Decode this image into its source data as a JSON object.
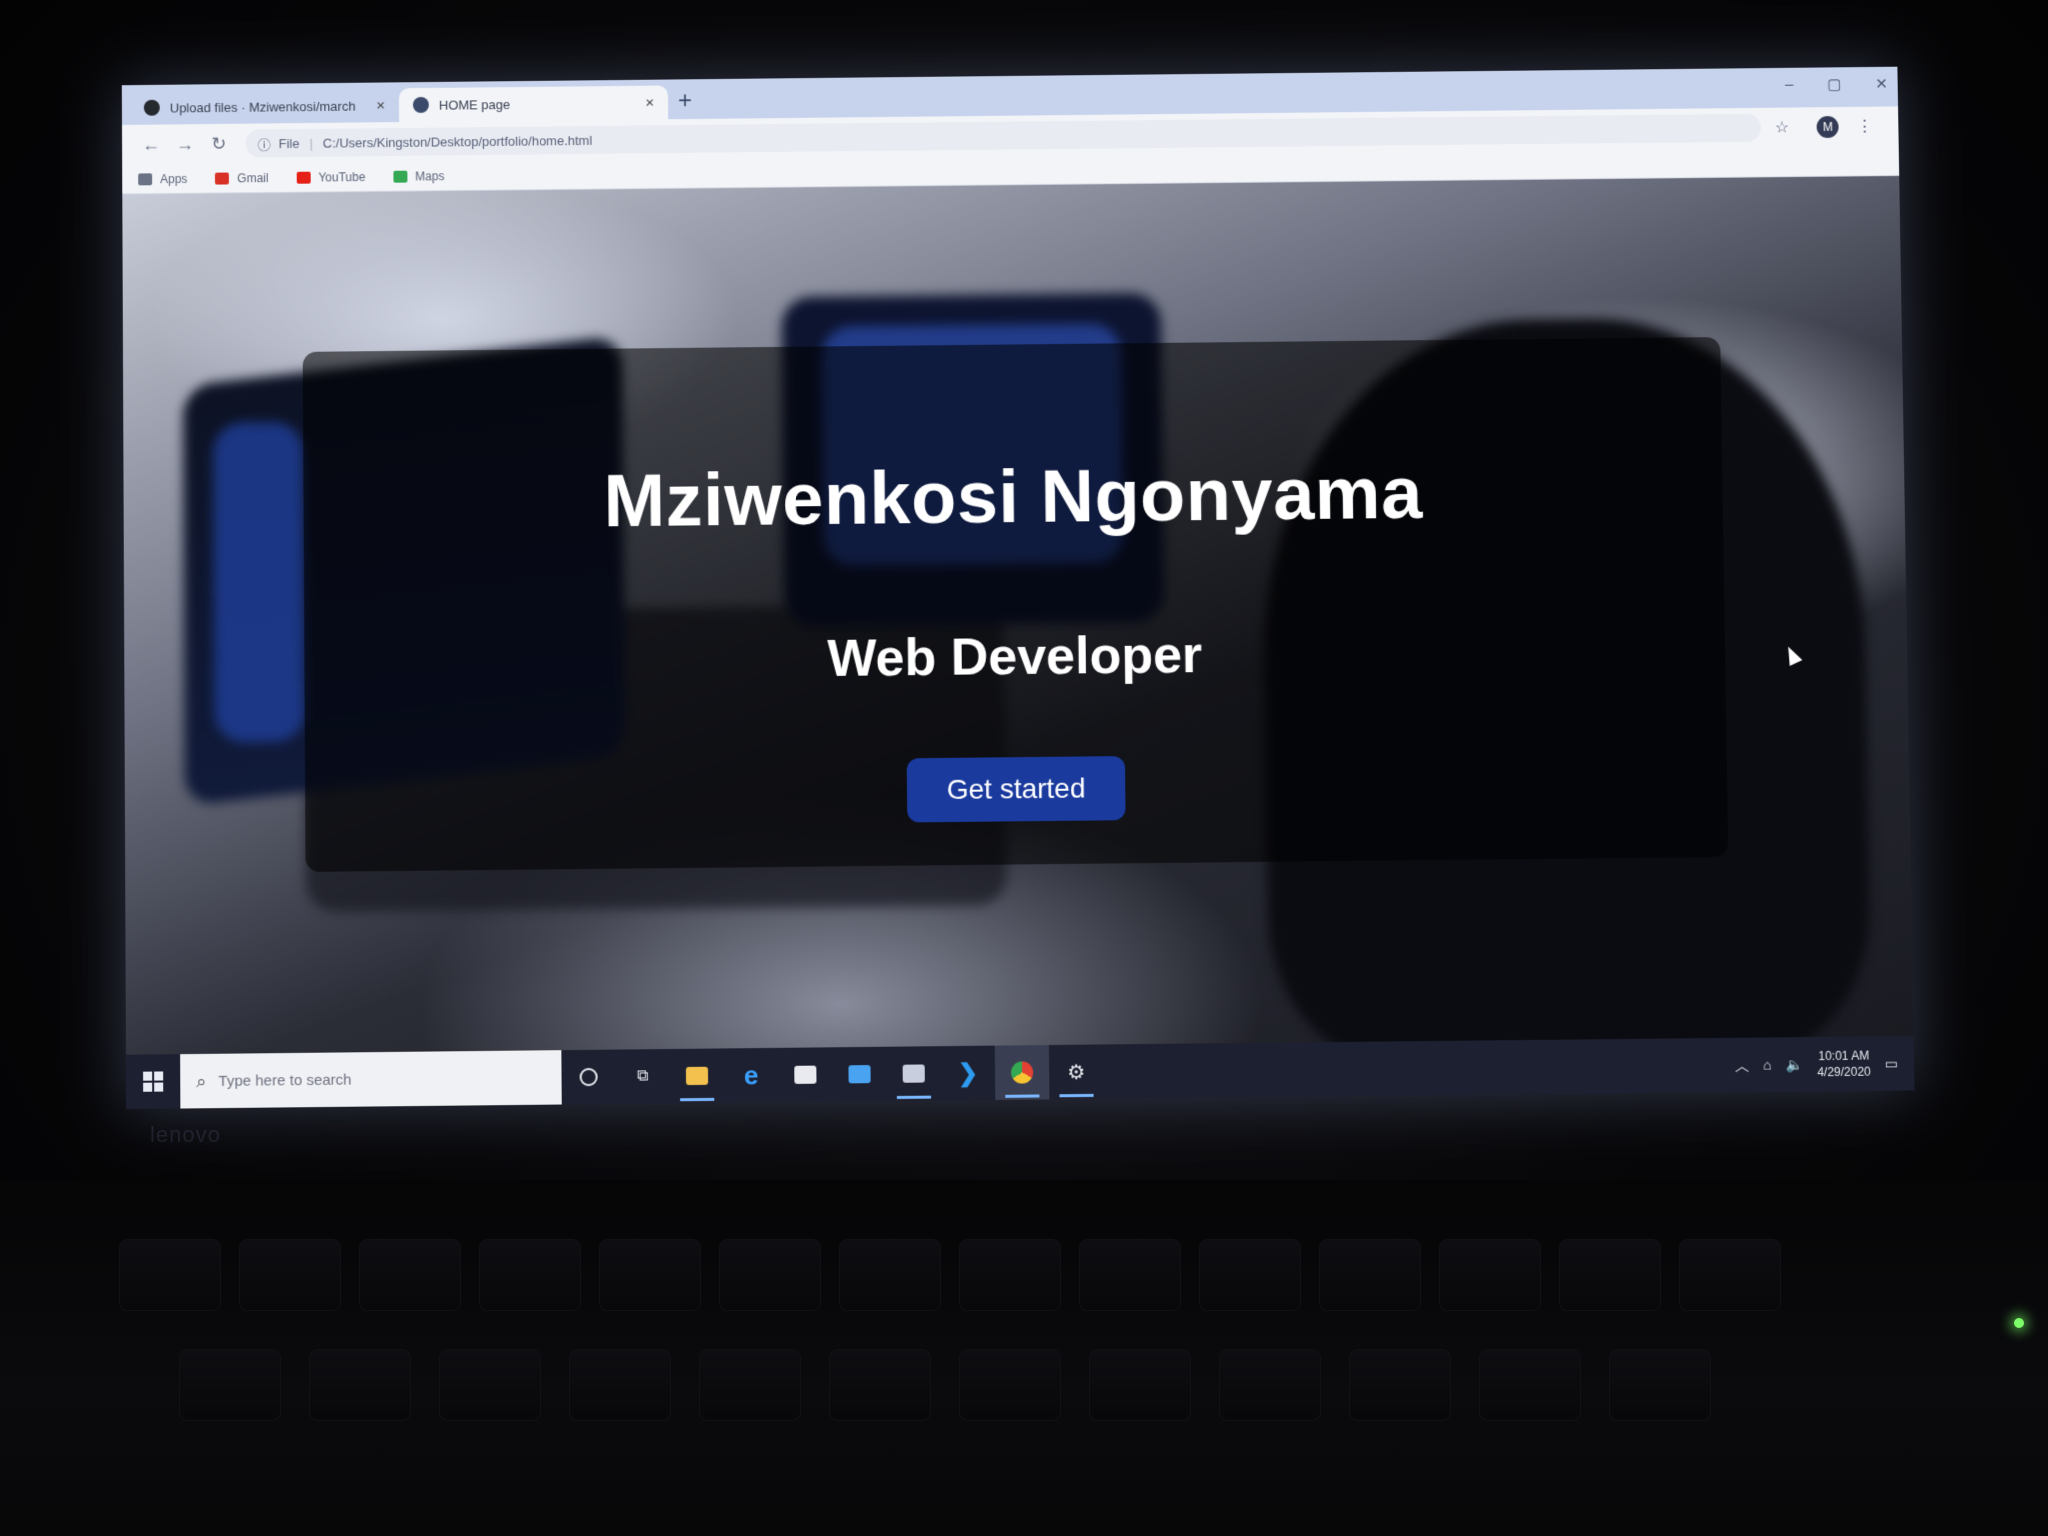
{
  "browser": {
    "tabs": [
      {
        "title": "Upload files · Mziwenkosi/march",
        "close": "×",
        "favicon": "github-icon"
      },
      {
        "title": "HOME page",
        "close": "×",
        "favicon": "globe-icon"
      }
    ],
    "new_tab": "+",
    "window_controls": {
      "minimize": "–",
      "maximize": "▢",
      "close": "✕"
    },
    "nav": {
      "back": "←",
      "forward": "→",
      "reload": "↻"
    },
    "address": {
      "scheme_icon": "ⓘ",
      "scheme": "File",
      "url": "C:/Users/Kingston/Desktop/portfolio/home.html"
    },
    "star": "☆",
    "profile_initial": "M",
    "menu": "⋮",
    "bookmarks": [
      {
        "label": "Apps",
        "icon": "apps-icon",
        "color": "#6b7285"
      },
      {
        "label": "Gmail",
        "icon": "gmail-icon",
        "color": "#d93025"
      },
      {
        "label": "YouTube",
        "icon": "youtube-icon",
        "color": "#e62117"
      },
      {
        "label": "Maps",
        "icon": "maps-icon",
        "color": "#34a853"
      }
    ]
  },
  "page": {
    "name": "Mziwenkosi Ngonyama",
    "role": "Web Developer",
    "cta": "Get started",
    "accent": "#1a3a9e"
  },
  "taskbar": {
    "search_placeholder": "Type here to search",
    "apps": [
      "cortana-icon",
      "task-view-icon",
      "file-explorer-icon",
      "edge-icon",
      "store-icon",
      "mail-icon",
      "media-icon",
      "vscode-icon",
      "chrome-icon",
      "settings-icon"
    ],
    "time": "10:01 AM",
    "date": "4/29/2020"
  },
  "device": {
    "brand": "lenovo"
  }
}
